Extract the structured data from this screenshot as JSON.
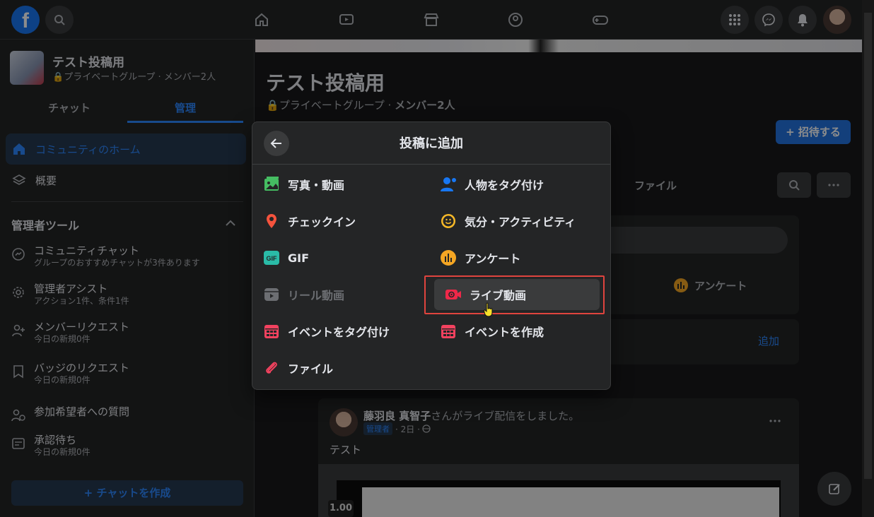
{
  "topbar": {
    "logo": "f",
    "nav_icons": [
      "home-icon",
      "watch-icon",
      "marketplace-icon",
      "groups-icon",
      "gaming-icon"
    ],
    "right_icons": [
      "menu-grid-icon",
      "messenger-icon",
      "bell-icon"
    ]
  },
  "sidebar": {
    "group_name": "テスト投稿用",
    "group_sub": "プライベートグループ · メンバー2人",
    "tabs": [
      {
        "label": "チャット"
      },
      {
        "label": "管理"
      }
    ],
    "items": [
      {
        "label": "コミュニティのホーム"
      },
      {
        "label": "概要"
      }
    ],
    "tools_title": "管理者ツール",
    "tools": [
      {
        "title": "コミュニティチャット",
        "sub": "グループのおすすめチャットが3件あります"
      },
      {
        "title": "管理者アシスト",
        "sub": "アクション1件、条件1件"
      },
      {
        "title": "メンバーリクエスト",
        "sub": "今日の新規0件"
      },
      {
        "title": "バッジのリクエスト",
        "sub": "今日の新規0件"
      },
      {
        "title": "参加希望者への質問",
        "sub": ""
      },
      {
        "title": "承認待ち",
        "sub": "今日の新規0件"
      }
    ],
    "create_chat": "+ チャットを作成"
  },
  "main": {
    "title": "テスト投稿用",
    "sub_prefix": "プライベートグループ · ",
    "sub_members": "メンバー2人",
    "invite": "+ 招待する",
    "tab_file": "ファイル",
    "bg_poll": "アンケート",
    "bg_add": "追加",
    "post": {
      "author": "藤羽良 真智子",
      "action": "さんがライブ配信をしました。",
      "badge": "管理者",
      "time": "· 2日 ·",
      "text": "テスト",
      "speed": "1.00"
    }
  },
  "modal": {
    "title": "投稿に追加",
    "options": [
      {
        "label": "写真・動画",
        "icon": "photo-icon",
        "color": "#45bd62"
      },
      {
        "label": "人物をタグ付け",
        "icon": "tag-people-icon",
        "color": "#1877f2"
      },
      {
        "label": "チェックイン",
        "icon": "location-pin-icon",
        "color": "#f5533d"
      },
      {
        "label": "気分・アクティビティ",
        "icon": "smiley-icon",
        "color": "#f7b928"
      },
      {
        "label": "GIF",
        "icon": "gif-icon",
        "color": "#2abba7"
      },
      {
        "label": "アンケート",
        "icon": "poll-icon",
        "color": "#f5a623"
      },
      {
        "label": "リール動画",
        "icon": "reels-icon",
        "color": "#6c6e72"
      },
      {
        "label": "ライブ動画",
        "icon": "live-video-icon",
        "color": "#f02849"
      },
      {
        "label": "イベントをタグ付け",
        "icon": "event-calendar-icon",
        "color": "#f3425f"
      },
      {
        "label": "イベントを作成",
        "icon": "event-create-icon",
        "color": "#f3425f"
      },
      {
        "label": "ファイル",
        "icon": "attachment-icon",
        "color": "#f3425f"
      }
    ]
  }
}
